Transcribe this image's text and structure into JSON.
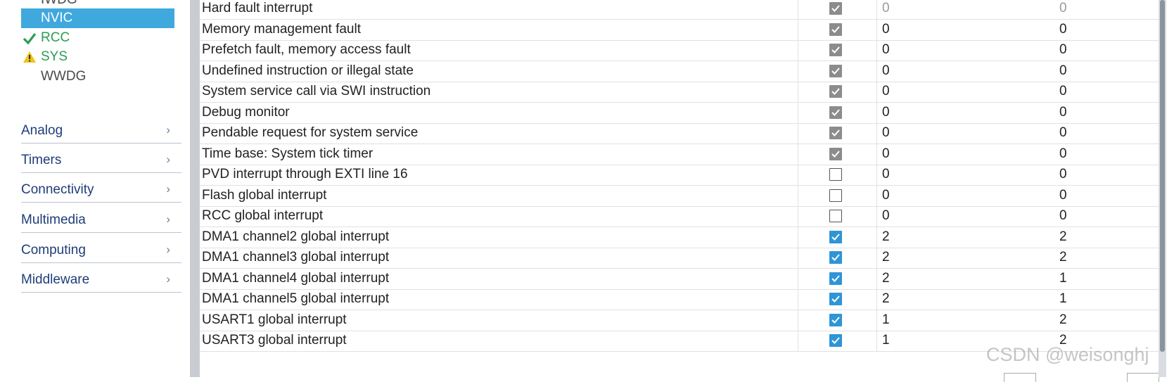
{
  "sidebar": {
    "peripherals": [
      {
        "label": "IWDG",
        "status": "none"
      },
      {
        "label": "NVIC",
        "status": "selected"
      },
      {
        "label": "RCC",
        "status": "ok"
      },
      {
        "label": "SYS",
        "status": "warning"
      },
      {
        "label": "WWDG",
        "status": "none"
      }
    ],
    "categories": [
      {
        "label": "Analog"
      },
      {
        "label": "Timers"
      },
      {
        "label": "Connectivity"
      },
      {
        "label": "Multimedia"
      },
      {
        "label": "Computing"
      },
      {
        "label": "Middleware"
      }
    ],
    "chevron": "›",
    "icons": {
      "ok": "check-icon",
      "warning": "warning-icon"
    },
    "colors": {
      "selected_bg": "#3fa9dd",
      "ok": "#2a9d54",
      "warning": "#f0c419",
      "category_text": "#1f3d7a"
    }
  },
  "nvic_table": {
    "rows": [
      {
        "name": "Hard fault interrupt",
        "enabled": "locked",
        "preemption": "0",
        "sub": "0",
        "dim": true
      },
      {
        "name": "Memory management fault",
        "enabled": "locked",
        "preemption": "0",
        "sub": "0"
      },
      {
        "name": "Prefetch fault, memory access fault",
        "enabled": "locked",
        "preemption": "0",
        "sub": "0"
      },
      {
        "name": "Undefined instruction or illegal state",
        "enabled": "locked",
        "preemption": "0",
        "sub": "0"
      },
      {
        "name": "System service call via SWI instruction",
        "enabled": "locked",
        "preemption": "0",
        "sub": "0"
      },
      {
        "name": "Debug monitor",
        "enabled": "locked",
        "preemption": "0",
        "sub": "0"
      },
      {
        "name": "Pendable request for system service",
        "enabled": "locked",
        "preemption": "0",
        "sub": "0"
      },
      {
        "name": "Time base: System tick timer",
        "enabled": "locked",
        "preemption": "0",
        "sub": "0"
      },
      {
        "name": "PVD interrupt through EXTI line 16",
        "enabled": "unchecked",
        "preemption": "0",
        "sub": "0"
      },
      {
        "name": "Flash global interrupt",
        "enabled": "unchecked",
        "preemption": "0",
        "sub": "0"
      },
      {
        "name": "RCC global interrupt",
        "enabled": "unchecked",
        "preemption": "0",
        "sub": "0"
      },
      {
        "name": "DMA1 channel2 global interrupt",
        "enabled": "checked",
        "preemption": "2",
        "sub": "2"
      },
      {
        "name": "DMA1 channel3 global interrupt",
        "enabled": "checked",
        "preemption": "2",
        "sub": "2"
      },
      {
        "name": "DMA1 channel4 global interrupt",
        "enabled": "checked",
        "preemption": "2",
        "sub": "1"
      },
      {
        "name": "DMA1 channel5 global interrupt",
        "enabled": "checked",
        "preemption": "2",
        "sub": "1"
      },
      {
        "name": "USART1 global interrupt",
        "enabled": "checked",
        "preemption": "1",
        "sub": "2"
      },
      {
        "name": "USART3 global interrupt",
        "enabled": "checked",
        "preemption": "1",
        "sub": "2"
      }
    ],
    "colors": {
      "checked": "#2f95d6",
      "locked": "#8c8c8c"
    }
  },
  "watermark": "CSDN @weisonghj"
}
